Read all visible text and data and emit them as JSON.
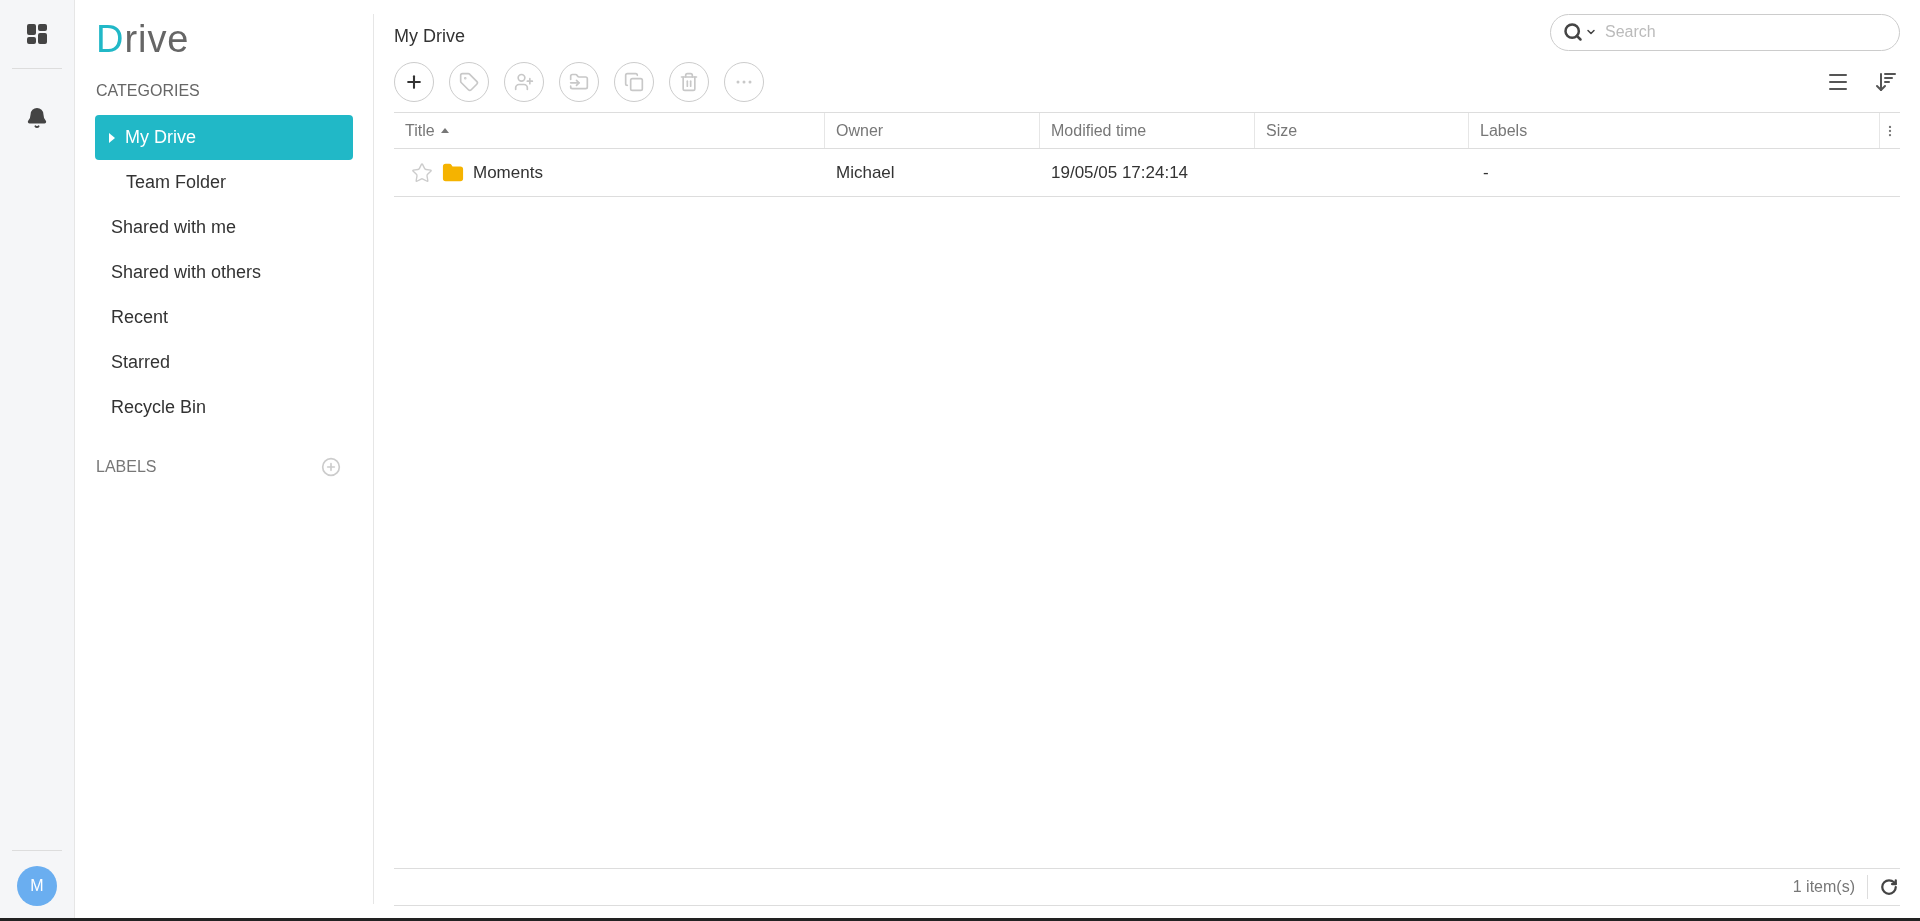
{
  "logo": "Drive",
  "categories": {
    "heading": "CATEGORIES",
    "items": [
      {
        "label": "My Drive",
        "selected": true,
        "expandable": true,
        "children": [
          {
            "label": "Team Folder",
            "selected": false
          }
        ]
      },
      {
        "label": "Shared with me",
        "selected": false
      },
      {
        "label": "Shared with others",
        "selected": false
      },
      {
        "label": "Recent",
        "selected": false
      },
      {
        "label": "Starred",
        "selected": false
      },
      {
        "label": "Recycle Bin",
        "selected": false
      }
    ]
  },
  "labels": {
    "heading": "LABELS"
  },
  "user": {
    "initial": "M"
  },
  "page_title": "My Drive",
  "search": {
    "placeholder": "Search"
  },
  "toolbar": [
    {
      "kind": "add",
      "disabled": false
    },
    {
      "kind": "tag",
      "disabled": true
    },
    {
      "kind": "share",
      "disabled": true
    },
    {
      "kind": "move",
      "disabled": true
    },
    {
      "kind": "copy",
      "disabled": true
    },
    {
      "kind": "delete",
      "disabled": true
    },
    {
      "kind": "more",
      "disabled": true
    }
  ],
  "table": {
    "columns": [
      {
        "label": "Title",
        "sorted": true
      },
      {
        "label": "Owner",
        "sorted": false
      },
      {
        "label": "Modified time",
        "sorted": false
      },
      {
        "label": "Size",
        "sorted": false
      },
      {
        "label": "Labels",
        "sorted": false
      }
    ],
    "rows": [
      {
        "starred": false,
        "title": "Moments",
        "owner": "Michael",
        "modified": "19/05/05 17:24:14",
        "labels": "-"
      }
    ]
  },
  "status_bar": {
    "count": "1 item(s)"
  }
}
